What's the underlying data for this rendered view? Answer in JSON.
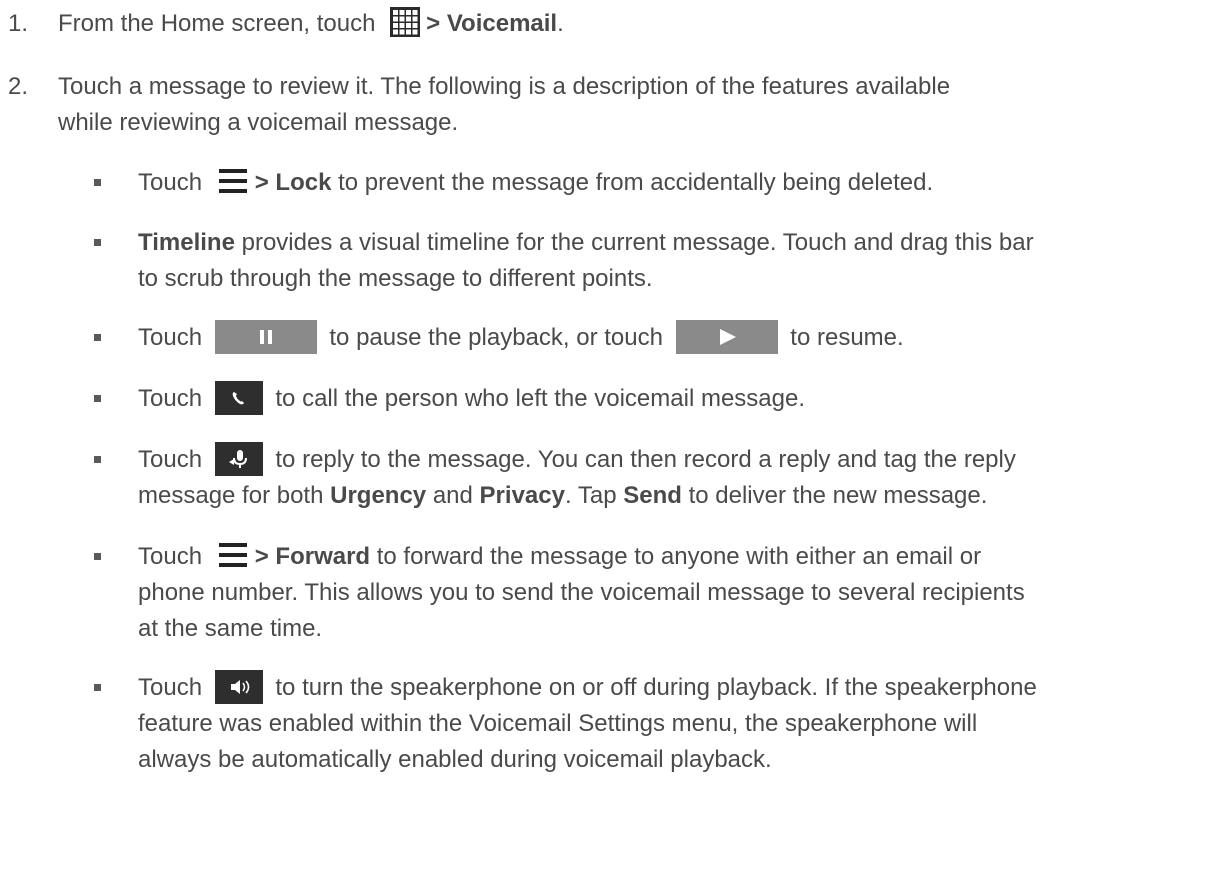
{
  "step1": {
    "num": "1.",
    "pre": "From the Home screen, touch",
    "bold": "> Voicemail",
    "post": ".",
    "icon": "apps-grid-icon"
  },
  "step2": {
    "num": "2.",
    "line1": "Touch a message to review it. The following is a description of the features available",
    "line2": "while reviewing a voicemail message."
  },
  "bullets": {
    "lock": {
      "pre": "Touch",
      "bold": "> Lock",
      "post": "to prevent the message from accidentally being deleted.",
      "icon": "menu-icon"
    },
    "timeline": {
      "bold": "Timeline",
      "line1": "provides a visual timeline for the current message. Touch and drag this bar",
      "line2": "to scrub through the message to different points."
    },
    "pause": {
      "pre": "Touch",
      "mid": "to pause the playback, or touch",
      "post": "to resume.",
      "pause_icon": "pause-icon",
      "play_icon": "play-icon"
    },
    "call": {
      "pre": "Touch",
      "post": "to call the person who left the voicemail message.",
      "icon": "phone-icon"
    },
    "reply": {
      "pre": "Touch",
      "post": "to reply to the message. You can then record a reply and tag the reply",
      "line2_pre": "message for both",
      "urgency": "Urgency",
      "and": "and",
      "privacy": "Privacy",
      "tap": ". Tap",
      "send": "Send",
      "line2_post": "to deliver the new message.",
      "icon": "reply-icon"
    },
    "forward": {
      "pre": "Touch",
      "bold": "> Forward",
      "post": "to forward the message to anyone with either an email or",
      "line2": "phone number. This allows you to send the voicemail message to several recipients",
      "line3": "at the same time.",
      "icon": "menu-icon"
    },
    "speaker": {
      "pre": "Touch",
      "post": "to turn the speakerphone on or off during playback. If the speakerphone",
      "line2": "feature was enabled within the Voicemail Settings menu, the speakerphone will",
      "line3": "always be automatically enabled during voicemail playback.",
      "icon": "speaker-icon"
    }
  },
  "colors": {
    "text": "#4a4a4a",
    "button_gray": "#8a8a8a",
    "button_dark": "#2e2e2e"
  }
}
